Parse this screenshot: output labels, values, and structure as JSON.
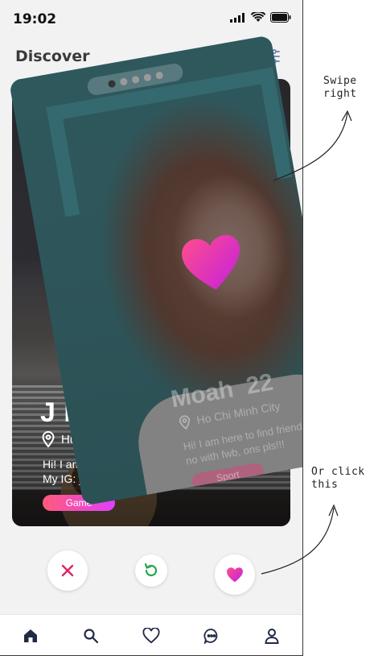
{
  "status_bar": {
    "time": "19:02"
  },
  "header": {
    "title": "Discover",
    "filter_icon": "sliders-icon"
  },
  "back_card": {
    "name": "J Lyu",
    "location": "Ho Chi Mi",
    "bio_line1": "Hi! I am here to",
    "bio_line2": "My IG: __abcxy",
    "tag": "Game"
  },
  "front_card": {
    "name": "Moah",
    "age": "22",
    "location": "Ho Chi Minh City",
    "bio": "Hi! I am here to find friends to Say no with fwb, ons pls!!!",
    "tag": "Sport",
    "page_dots": 5,
    "active_dot": 0
  },
  "actions": {
    "dislike": "close-icon",
    "undo": "undo-icon",
    "like": "heart-icon"
  },
  "bottom_nav": [
    {
      "icon": "home-icon",
      "active": true
    },
    {
      "icon": "search-icon",
      "active": false
    },
    {
      "icon": "heart-icon",
      "active": false
    },
    {
      "icon": "chat-icon",
      "active": false
    },
    {
      "icon": "profile-icon",
      "active": false
    }
  ],
  "annotations": {
    "swipe_line1": "Swipe",
    "swipe_line2": "right",
    "click_line1": "Or click",
    "click_line2": "this"
  },
  "colors": {
    "accent_pink": "#e040fb",
    "accent_red": "#ff5a7a",
    "nav_active": "#1f2a44",
    "undo_green": "#22a84a"
  }
}
